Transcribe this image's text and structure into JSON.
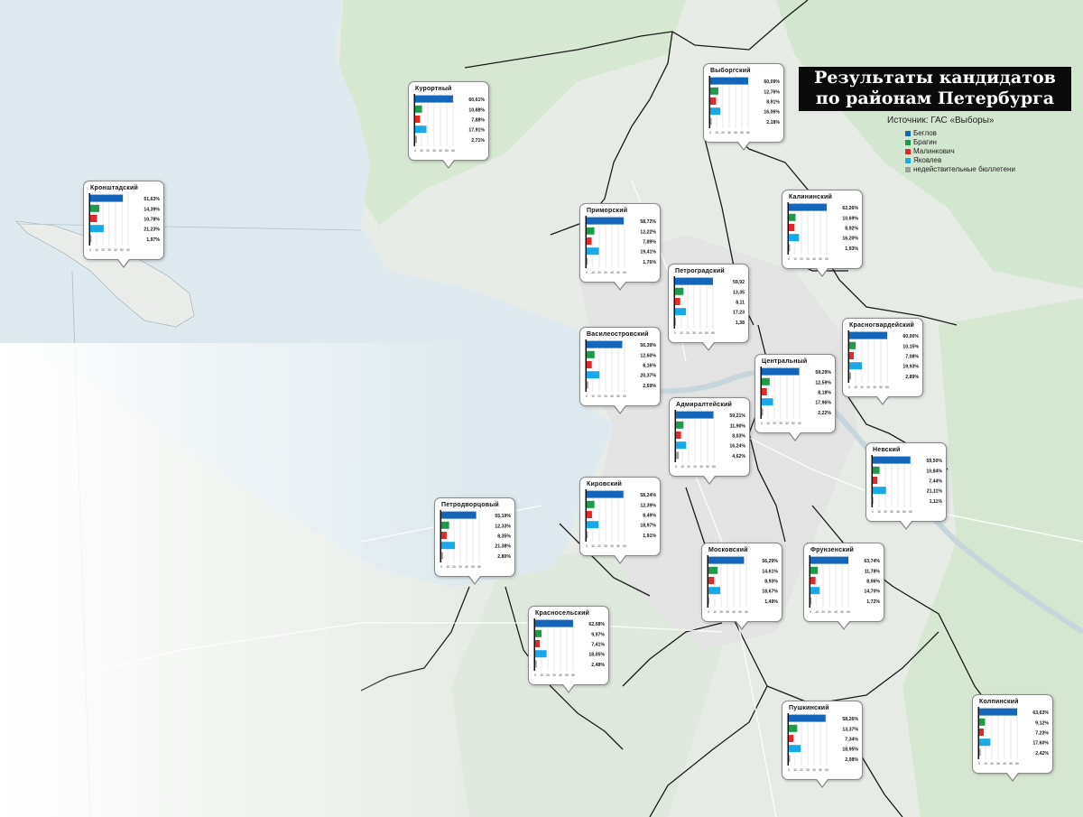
{
  "title": {
    "line1": "Результаты кандидатов",
    "line2": "по районам Петербурга"
  },
  "source": "Источник: ГАС «Выборы»",
  "colors": {
    "beglov": "#1565b8",
    "bragin": "#1f9a4a",
    "malinkovich": "#e02a2a",
    "yakovlev": "#19a9e6",
    "invalid": "#9e9e9e"
  },
  "legend": [
    {
      "label": "Беглов",
      "color": "#1565b8"
    },
    {
      "label": "Брагин",
      "color": "#1f9a4a"
    },
    {
      "label": "Малинкович",
      "color": "#e02a2a"
    },
    {
      "label": "Яковлев",
      "color": "#19a9e6"
    },
    {
      "label": "недействительные бюллетени",
      "color": "#9e9e9e"
    }
  ],
  "axis_ticks": [
    "0",
    "10",
    "20",
    "30",
    "40",
    "50",
    "60"
  ],
  "chart_data": {
    "type": "bar",
    "series_names": [
      "Беглов",
      "Брагин",
      "Малинкович",
      "Яковлев",
      "недействительные бюллетени"
    ],
    "xlim": [
      0,
      60
    ],
    "districts": [
      {
        "name": "Кронштадский",
        "labels": [
          "51,63%",
          "14,39%",
          "10,78%",
          "21,23%",
          "1,97%"
        ],
        "values": [
          51.63,
          14.39,
          10.78,
          21.23,
          1.97
        ]
      },
      {
        "name": "Курортный",
        "labels": [
          "60,61%",
          "10,88%",
          "7,88%",
          "17,91%",
          "2,71%"
        ],
        "values": [
          60.61,
          10.88,
          7.88,
          17.91,
          2.71
        ]
      },
      {
        "name": "Выборгский",
        "labels": [
          "60,09%",
          "12,76%",
          "8,91%",
          "16,06%",
          "2,18%"
        ],
        "values": [
          60.09,
          12.76,
          8.91,
          16.06,
          2.18
        ]
      },
      {
        "name": "Приморский",
        "labels": [
          "58,72%",
          "12,22%",
          "7,89%",
          "19,41%",
          "1,76%"
        ],
        "values": [
          58.72,
          12.22,
          7.89,
          19.41,
          1.76
        ]
      },
      {
        "name": "Калининский",
        "labels": [
          "62,26%",
          "10,69%",
          "8,92%",
          "16,20%",
          "1,93%"
        ],
        "values": [
          62.26,
          10.69,
          8.92,
          16.2,
          1.93
        ]
      },
      {
        "name": "Петроградский",
        "labels": [
          "59,92",
          "13,35",
          "8,11",
          "17,23",
          "1,38"
        ],
        "values": [
          59.92,
          13.35,
          8.11,
          17.23,
          1.38
        ]
      },
      {
        "name": "Василеостровский",
        "labels": [
          "56,39%",
          "12,60%",
          "8,16%",
          "20,37%",
          "2,69%"
        ],
        "values": [
          56.39,
          12.6,
          8.16,
          20.37,
          2.69
        ]
      },
      {
        "name": "Красногвардейский",
        "labels": [
          "60,00%",
          "10,15%",
          "7,08%",
          "19,93%",
          "2,89%"
        ],
        "values": [
          60.0,
          10.15,
          7.08,
          19.93,
          2.89
        ]
      },
      {
        "name": "Центральный",
        "labels": [
          "59,29%",
          "12,59%",
          "8,18%",
          "17,96%",
          "2,22%"
        ],
        "values": [
          59.29,
          12.59,
          8.18,
          17.96,
          2.22
        ]
      },
      {
        "name": "Адмиралтейский",
        "labels": [
          "59,21%",
          "11,90%",
          "8,03%",
          "16,24%",
          "4,62%"
        ],
        "values": [
          59.21,
          11.9,
          8.03,
          16.24,
          4.62
        ]
      },
      {
        "name": "Невский",
        "labels": [
          "59,50%",
          "10,84%",
          "7,44%",
          "21,11%",
          "1,11%"
        ],
        "values": [
          59.5,
          10.84,
          7.44,
          21.11,
          1.11
        ]
      },
      {
        "name": "Кировский",
        "labels": [
          "58,24%",
          "12,39%",
          "8,49%",
          "18,97%",
          "1,91%"
        ],
        "values": [
          58.24,
          12.39,
          8.49,
          18.97,
          1.91
        ]
      },
      {
        "name": "Петродворцовый",
        "labels": [
          "55,19%",
          "12,33%",
          "8,35%",
          "21,38%",
          "2,80%"
        ],
        "values": [
          55.19,
          12.33,
          8.35,
          21.38,
          2.8
        ]
      },
      {
        "name": "Московский",
        "labels": [
          "56,29%",
          "14,61%",
          "8,93%",
          "18,67%",
          "1,49%"
        ],
        "values": [
          56.29,
          14.61,
          8.93,
          18.67,
          1.49
        ]
      },
      {
        "name": "Фрунзенский",
        "labels": [
          "63,74%",
          "11,78%",
          "8,06%",
          "14,70%",
          "1,72%"
        ],
        "values": [
          63.74,
          11.78,
          8.06,
          14.7,
          1.72
        ]
      },
      {
        "name": "Красносельский",
        "labels": [
          "62,08%",
          "9,97%",
          "7,41%",
          "18,05%",
          "2,48%"
        ],
        "values": [
          62.08,
          9.97,
          7.41,
          18.05,
          2.48
        ]
      },
      {
        "name": "Пушкинский",
        "labels": [
          "58,26%",
          "13,37%",
          "7,34%",
          "18,95%",
          "2,08%"
        ],
        "values": [
          58.26,
          13.37,
          7.34,
          18.95,
          2.08
        ]
      },
      {
        "name": "Колпинский",
        "labels": [
          "63,63%",
          "9,12%",
          "7,23%",
          "17,60%",
          "2,42%"
        ],
        "values": [
          63.63,
          9.12,
          7.23,
          17.6,
          2.42
        ]
      }
    ]
  }
}
